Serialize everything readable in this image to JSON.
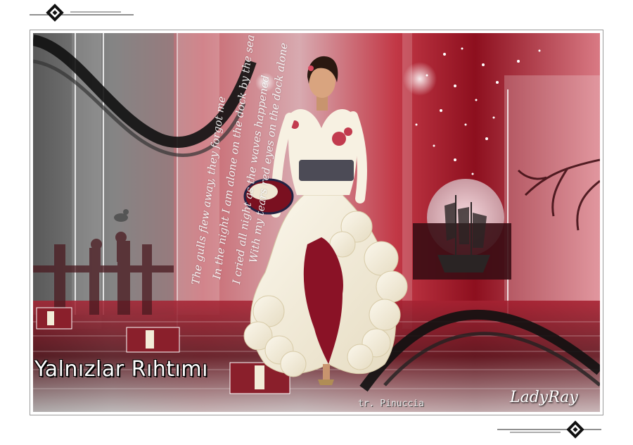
{
  "colors": {
    "accent_red": "#b3182b",
    "dark_red": "#7a0c19",
    "cream": "#f3ecd8",
    "black": "#111111"
  },
  "artwork": {
    "title": "Yalnızlar Rıhtımı",
    "credit": "tr. Pinuccia",
    "signature": "LadyRay",
    "poem": [
      "The gulls flew away, they forgot me",
      "In the night I am alone on the dock by the sea",
      "I cried all night as the waves happened",
      "With my tears red eyes on the dock alone"
    ]
  }
}
